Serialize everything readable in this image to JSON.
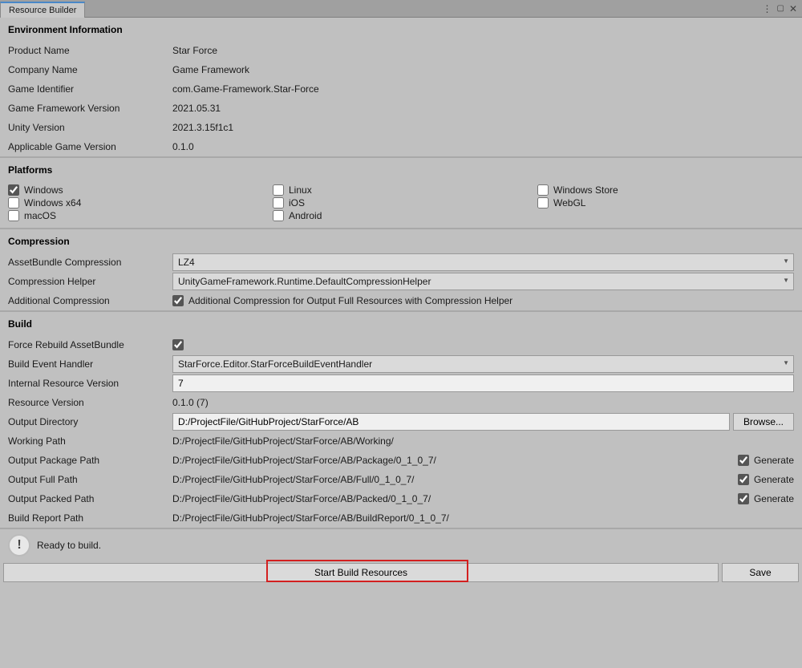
{
  "tab": {
    "title": "Resource Builder"
  },
  "sections": {
    "env": {
      "title": "Environment Information",
      "productNameLabel": "Product Name",
      "productName": "Star Force",
      "companyNameLabel": "Company Name",
      "companyName": "Game Framework",
      "gameIdentifierLabel": "Game Identifier",
      "gameIdentifier": "com.Game-Framework.Star-Force",
      "gfVersionLabel": "Game Framework Version",
      "gfVersion": "2021.05.31",
      "unityVersionLabel": "Unity Version",
      "unityVersion": "2021.3.15f1c1",
      "appGameVersionLabel": "Applicable Game Version",
      "appGameVersion": "0.1.0"
    },
    "platforms": {
      "title": "Platforms",
      "items": [
        {
          "label": "Windows",
          "checked": true
        },
        {
          "label": "Linux",
          "checked": false
        },
        {
          "label": "Windows Store",
          "checked": false
        },
        {
          "label": "Windows x64",
          "checked": false
        },
        {
          "label": "iOS",
          "checked": false
        },
        {
          "label": "WebGL",
          "checked": false
        },
        {
          "label": "macOS",
          "checked": false
        },
        {
          "label": "Android",
          "checked": false
        }
      ]
    },
    "compression": {
      "title": "Compression",
      "abCompLabel": "AssetBundle Compression",
      "abComp": "LZ4",
      "helperLabel": "Compression Helper",
      "helper": "UnityGameFramework.Runtime.DefaultCompressionHelper",
      "addlLabel": "Additional Compression",
      "addlText": "Additional Compression for Output Full Resources with Compression Helper",
      "addlChecked": true
    },
    "build": {
      "title": "Build",
      "forceRebuildLabel": "Force Rebuild AssetBundle",
      "forceRebuildChecked": true,
      "eventHandlerLabel": "Build Event Handler",
      "eventHandler": "StarForce.Editor.StarForceBuildEventHandler",
      "internalVerLabel": "Internal Resource Version",
      "internalVer": "7",
      "resVerLabel": "Resource Version",
      "resVer": "0.1.0 (7)",
      "outDirLabel": "Output Directory",
      "outDir": "D:/ProjectFile/GitHubProject/StarForce/AB",
      "browseLabel": "Browse...",
      "workingLabel": "Working Path",
      "working": "D:/ProjectFile/GitHubProject/StarForce/AB/Working/",
      "pkgLabel": "Output Package Path",
      "pkg": "D:/ProjectFile/GitHubProject/StarForce/AB/Package/0_1_0_7/",
      "fullLabel": "Output Full Path",
      "full": "D:/ProjectFile/GitHubProject/StarForce/AB/Full/0_1_0_7/",
      "packedLabel": "Output Packed Path",
      "packed": "D:/ProjectFile/GitHubProject/StarForce/AB/Packed/0_1_0_7/",
      "reportLabel": "Build Report Path",
      "report": "D:/ProjectFile/GitHubProject/StarForce/AB/BuildReport/0_1_0_7/",
      "generateLabel": "Generate",
      "pkgGen": true,
      "fullGen": true,
      "packedGen": true
    }
  },
  "status": {
    "text": "Ready to build."
  },
  "buttons": {
    "start": "Start Build Resources",
    "save": "Save"
  }
}
